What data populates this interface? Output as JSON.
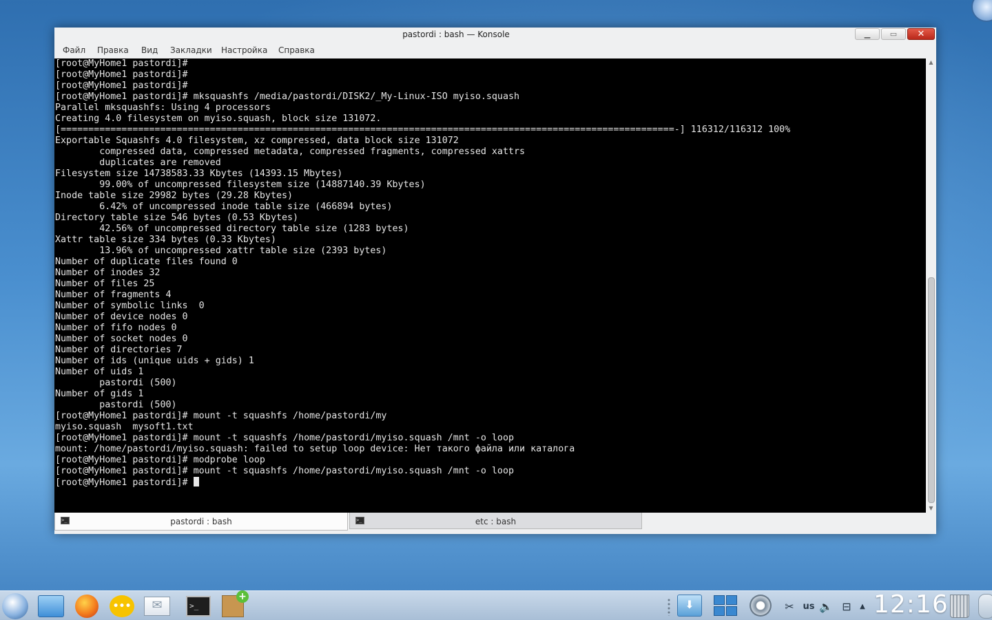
{
  "window": {
    "title": "pastordi : bash — Konsole",
    "controls": {
      "minimize": "▁",
      "maximize": "▭",
      "close": "✕"
    }
  },
  "menu": [
    "Файл",
    "Правка",
    "Вид",
    "Закладки",
    "Настройка",
    "Справка"
  ],
  "terminal": {
    "lines": [
      "[root@MyHome1 pastordi]#",
      "[root@MyHome1 pastordi]#",
      "[root@MyHome1 pastordi]#",
      "[root@MyHome1 pastordi]# mksquashfs /media/pastordi/DISK2/_My-Linux-ISO myiso.squash",
      "Parallel mksquashfs: Using 4 processors",
      "Creating 4.0 filesystem on myiso.squash, block size 131072.",
      "[===============================================================================================================-] 116312/116312 100%",
      "Exportable Squashfs 4.0 filesystem, xz compressed, data block size 131072",
      "        compressed data, compressed metadata, compressed fragments, compressed xattrs",
      "        duplicates are removed",
      "Filesystem size 14738583.33 Kbytes (14393.15 Mbytes)",
      "        99.00% of uncompressed filesystem size (14887140.39 Kbytes)",
      "Inode table size 29982 bytes (29.28 Kbytes)",
      "        6.42% of uncompressed inode table size (466894 bytes)",
      "Directory table size 546 bytes (0.53 Kbytes)",
      "        42.56% of uncompressed directory table size (1283 bytes)",
      "Xattr table size 334 bytes (0.33 Kbytes)",
      "        13.96% of uncompressed xattr table size (2393 bytes)",
      "Number of duplicate files found 0",
      "Number of inodes 32",
      "Number of files 25",
      "Number of fragments 4",
      "Number of symbolic links  0",
      "Number of device nodes 0",
      "Number of fifo nodes 0",
      "Number of socket nodes 0",
      "Number of directories 7",
      "Number of ids (unique uids + gids) 1",
      "Number of uids 1",
      "        pastordi (500)",
      "Number of gids 1",
      "        pastordi (500)",
      "[root@MyHome1 pastordi]# mount -t squashfs /home/pastordi/my",
      "myiso.squash  mysoft1.txt",
      "[root@MyHome1 pastordi]# mount -t squashfs /home/pastordi/myiso.squash /mnt -o loop",
      "mount: /home/pastordi/myiso.squash: failed to setup loop device: Нет такого файла или каталога",
      "[root@MyHome1 pastordi]# modprobe loop",
      "[root@MyHome1 pastordi]# mount -t squashfs /home/pastordi/myiso.squash /mnt -o loop"
    ],
    "prompt": "[root@MyHome1 pastordi]# ",
    "scroll_position": 0.49
  },
  "tabs": [
    {
      "label": "pastordi : bash",
      "active": true
    },
    {
      "label": "etc : bash",
      "active": false
    }
  ],
  "taskbar": {
    "launchers": [
      "kde-menu-icon",
      "dolphin-icon",
      "firefox-icon",
      "chat-icon",
      "mail-icon",
      "konsole-icon",
      "installer-icon"
    ],
    "tray": {
      "keyboard_layout": "us",
      "clock": "12:16"
    }
  }
}
